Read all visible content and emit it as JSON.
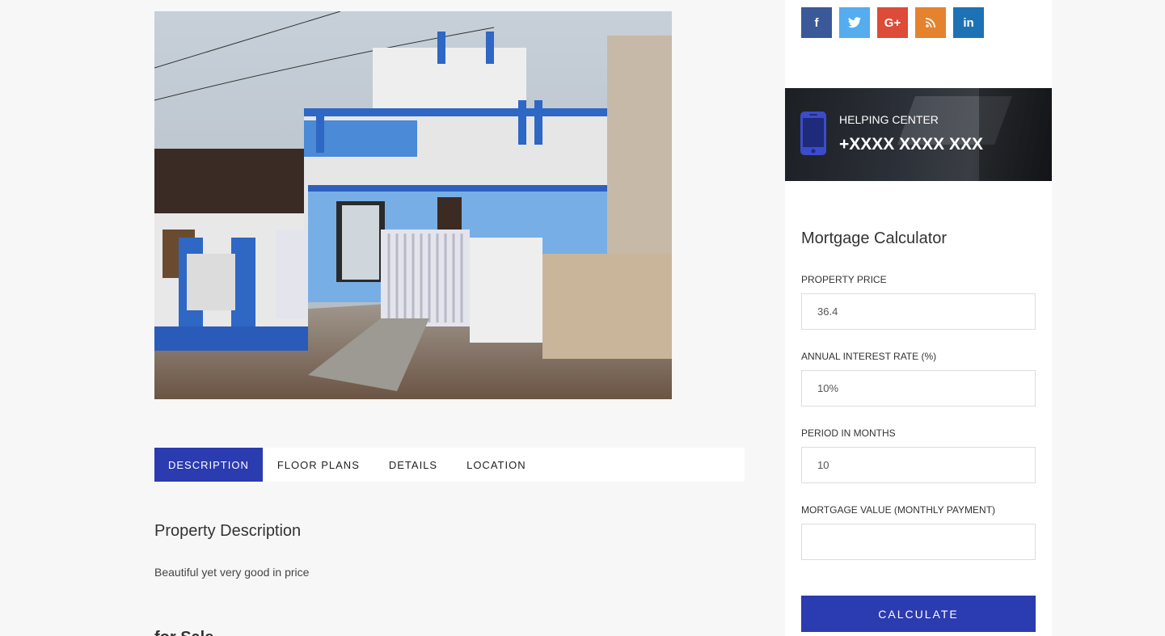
{
  "tabs": [
    {
      "label": "DESCRIPTION",
      "active": true
    },
    {
      "label": "FLOOR PLANS",
      "active": false
    },
    {
      "label": "DETAILS",
      "active": false
    },
    {
      "label": "LOCATION",
      "active": false
    }
  ],
  "description": {
    "title": "Property Description",
    "text": "Beautiful yet very good in price",
    "next_heading_partial": "for Sale"
  },
  "social": [
    {
      "name": "facebook",
      "glyph": "f",
      "color": "#3b5998"
    },
    {
      "name": "twitter",
      "glyph": "t",
      "color": "#55acee"
    },
    {
      "name": "google-plus",
      "glyph": "G+",
      "color": "#dd4b39"
    },
    {
      "name": "rss",
      "glyph": "rss",
      "color": "#e5822e"
    },
    {
      "name": "linkedin",
      "glyph": "in",
      "color": "#1d72b5"
    }
  ],
  "helping_center": {
    "label": "HELPING CENTER",
    "phone": "+XXXX XXXX XXX",
    "icon": "mobile-phone-icon",
    "icon_color": "#3b4cca"
  },
  "mortgage": {
    "title": "Mortgage Calculator",
    "fields": [
      {
        "label": "PROPERTY PRICE",
        "value": "36.4"
      },
      {
        "label": "ANNUAL INTEREST RATE (%)",
        "value": "10%"
      },
      {
        "label": "PERIOD IN MONTHS",
        "value": "10"
      },
      {
        "label": "MORTGAGE VALUE (MONTHLY PAYMENT)",
        "value": ""
      }
    ],
    "button_label": "CALCULATE"
  },
  "colors": {
    "accent": "#2b3bb0",
    "page_bg": "#f7f7f7"
  }
}
